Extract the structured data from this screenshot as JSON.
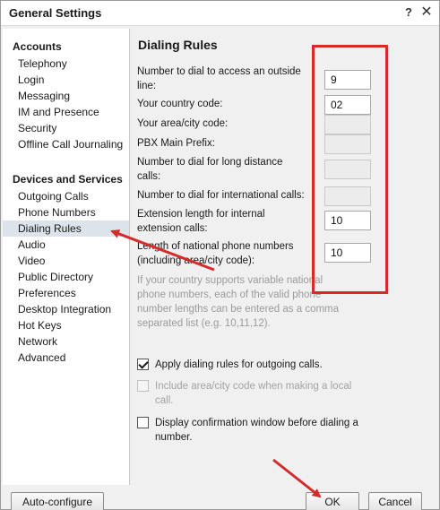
{
  "window": {
    "title": "General Settings",
    "help_glyph": "?",
    "close_glyph": "✕"
  },
  "sidebar": {
    "groups": [
      {
        "title": "Accounts",
        "items": [
          "Telephony",
          "Login",
          "Messaging",
          "IM and Presence",
          "Security",
          "Offline Call Journaling"
        ]
      },
      {
        "title": "Devices and Services",
        "items": [
          "Outgoing Calls",
          "Phone Numbers",
          "Dialing Rules",
          "Audio",
          "Video",
          "Public Directory",
          "Preferences",
          "Desktop Integration",
          "Hot Keys",
          "Network",
          "Advanced"
        ]
      }
    ],
    "selected_item": "Dialing Rules"
  },
  "main": {
    "section_title": "Dialing Rules",
    "fields": [
      {
        "label_lines": [
          "Number to dial to access an outside",
          "line:"
        ],
        "value": "9",
        "enabled": true
      },
      {
        "label_lines": [
          "Your country code:"
        ],
        "value": "02",
        "enabled": true
      },
      {
        "label_lines": [
          "Your area/city code:"
        ],
        "value": "",
        "enabled": false
      },
      {
        "label_lines": [
          "PBX Main Prefix:"
        ],
        "value": "",
        "enabled": false
      },
      {
        "label_lines": [
          "Number to dial for long distance",
          "calls:"
        ],
        "value": "",
        "enabled": false
      },
      {
        "label_lines": [
          "Number to dial for international calls:"
        ],
        "value": "",
        "enabled": false
      },
      {
        "label_lines": [
          "Extension length for internal",
          "extension calls:"
        ],
        "value": "10",
        "enabled": true
      },
      {
        "label_lines": [
          "Length of national phone numbers",
          "(including area/city code):"
        ],
        "value": "10",
        "enabled": true
      }
    ],
    "info_lines": [
      "If your country supports variable national",
      "phone numbers, each of the valid phone",
      "number lengths can be entered as a comma",
      "separated list (e.g. 10,11,12)."
    ],
    "checkboxes": [
      {
        "lines": [
          "Apply dialing rules for outgoing calls."
        ],
        "checked": true,
        "enabled": true
      },
      {
        "lines": [
          "Include area/city code when making a local",
          "call."
        ],
        "checked": false,
        "enabled": false
      },
      {
        "lines": [
          "Display confirmation window before dialing a",
          "number."
        ],
        "checked": false,
        "enabled": true
      }
    ]
  },
  "footer": {
    "auto_configure_label": "Auto-configure",
    "ok_label": "OK",
    "cancel_label": "Cancel"
  },
  "colors": {
    "annotation_red": "#d42b2b",
    "selected_item_bg": "#dde3ea"
  }
}
